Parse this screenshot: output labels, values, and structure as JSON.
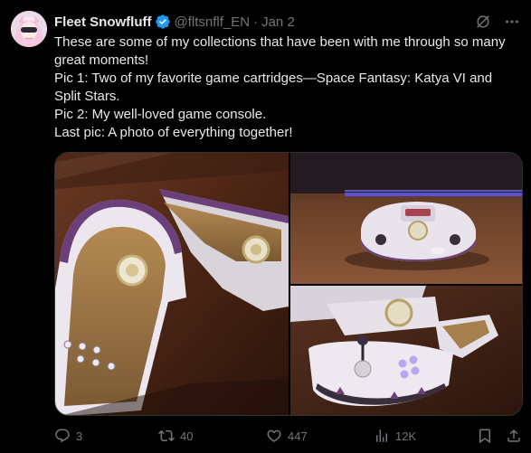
{
  "author": {
    "name": "Fleet Snowfluff",
    "handle": "@fltsnflf_EN",
    "separator": "·",
    "date": "Jan 2",
    "verified": true
  },
  "tweet_text": [
    "These are some of my collections that have been with me through so many great moments!",
    "Pic 1: Two of my favorite game cartridges—Space Fantasy: Katya VI and Split Stars.",
    "Pic 2: My well-loved game console.",
    "Last pic: A photo of everything together!"
  ],
  "media": {
    "count": 3,
    "items": [
      {
        "subject": "game-cartridges"
      },
      {
        "subject": "game-console"
      },
      {
        "subject": "everything-together"
      }
    ]
  },
  "actions": {
    "replies": "3",
    "reposts": "40",
    "likes": "447",
    "views": "12K"
  },
  "colors": {
    "background": "#000000",
    "text": "#e7e9ea",
    "muted": "#71767b",
    "verified": "#1d9bf0",
    "border": "#2f3336"
  },
  "icons": [
    "grok-icon",
    "more-icon",
    "verified-badge-icon",
    "reply-icon",
    "repost-icon",
    "like-icon",
    "views-icon",
    "bookmark-icon",
    "share-icon"
  ]
}
